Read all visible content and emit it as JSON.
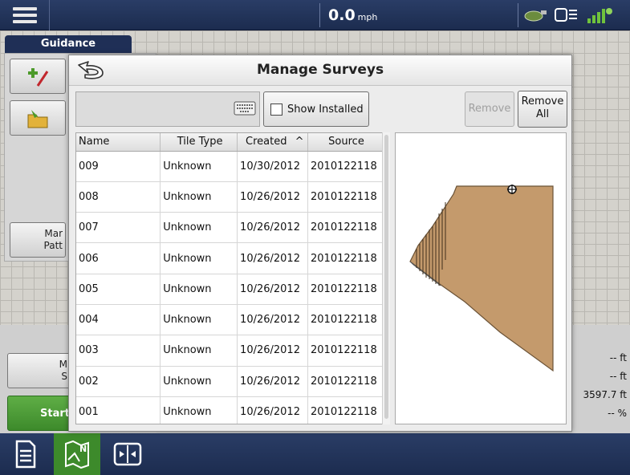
{
  "topbar": {
    "speed_value": "0.0",
    "speed_unit": "mph"
  },
  "guidance": {
    "tab_label": "Guidance",
    "manage_patterns_label": [
      "Mar",
      "Patt"
    ],
    "manage_surveys_label": [
      "M",
      "S"
    ],
    "start_label": "Start"
  },
  "status_readouts": [
    "-- ft",
    "-- ft",
    "3597.7 ft",
    "-- %"
  ],
  "modal": {
    "title": "Manage Surveys",
    "search_value": "",
    "show_installed_label": "Show Installed",
    "show_installed_checked": false,
    "remove_label": "Remove",
    "remove_all_label": [
      "Remove",
      "All"
    ],
    "columns": [
      "Name",
      "Tile Type",
      "Created",
      "Source"
    ],
    "sort_column": "Created",
    "sort_direction": "ascending",
    "sort_indicator": "^",
    "rows": [
      {
        "name": "009",
        "tile_type": "Unknown",
        "created": "10/30/2012",
        "source": "2010122118"
      },
      {
        "name": "008",
        "tile_type": "Unknown",
        "created": "10/26/2012",
        "source": "2010122118"
      },
      {
        "name": "007",
        "tile_type": "Unknown",
        "created": "10/26/2012",
        "source": "2010122118"
      },
      {
        "name": "006",
        "tile_type": "Unknown",
        "created": "10/26/2012",
        "source": "2010122118"
      },
      {
        "name": "005",
        "tile_type": "Unknown",
        "created": "10/26/2012",
        "source": "2010122118"
      },
      {
        "name": "004",
        "tile_type": "Unknown",
        "created": "10/26/2012",
        "source": "2010122118"
      },
      {
        "name": "003",
        "tile_type": "Unknown",
        "created": "10/26/2012",
        "source": "2010122118"
      },
      {
        "name": "002",
        "tile_type": "Unknown",
        "created": "10/26/2012",
        "source": "2010122118"
      },
      {
        "name": "001",
        "tile_type": "Unknown",
        "created": "10/26/2012",
        "source": "2010122118"
      }
    ]
  },
  "colors": {
    "field_fill": "#c49a6c",
    "start_button": "#4a9a35",
    "topbar": "#233660"
  },
  "icons": [
    "menu-icon",
    "tank-icon",
    "display-icon",
    "gps-signal-icon",
    "back-arrow-icon",
    "keyboard-icon",
    "run-page-icon",
    "map-page-icon",
    "split-screen-icon"
  ]
}
